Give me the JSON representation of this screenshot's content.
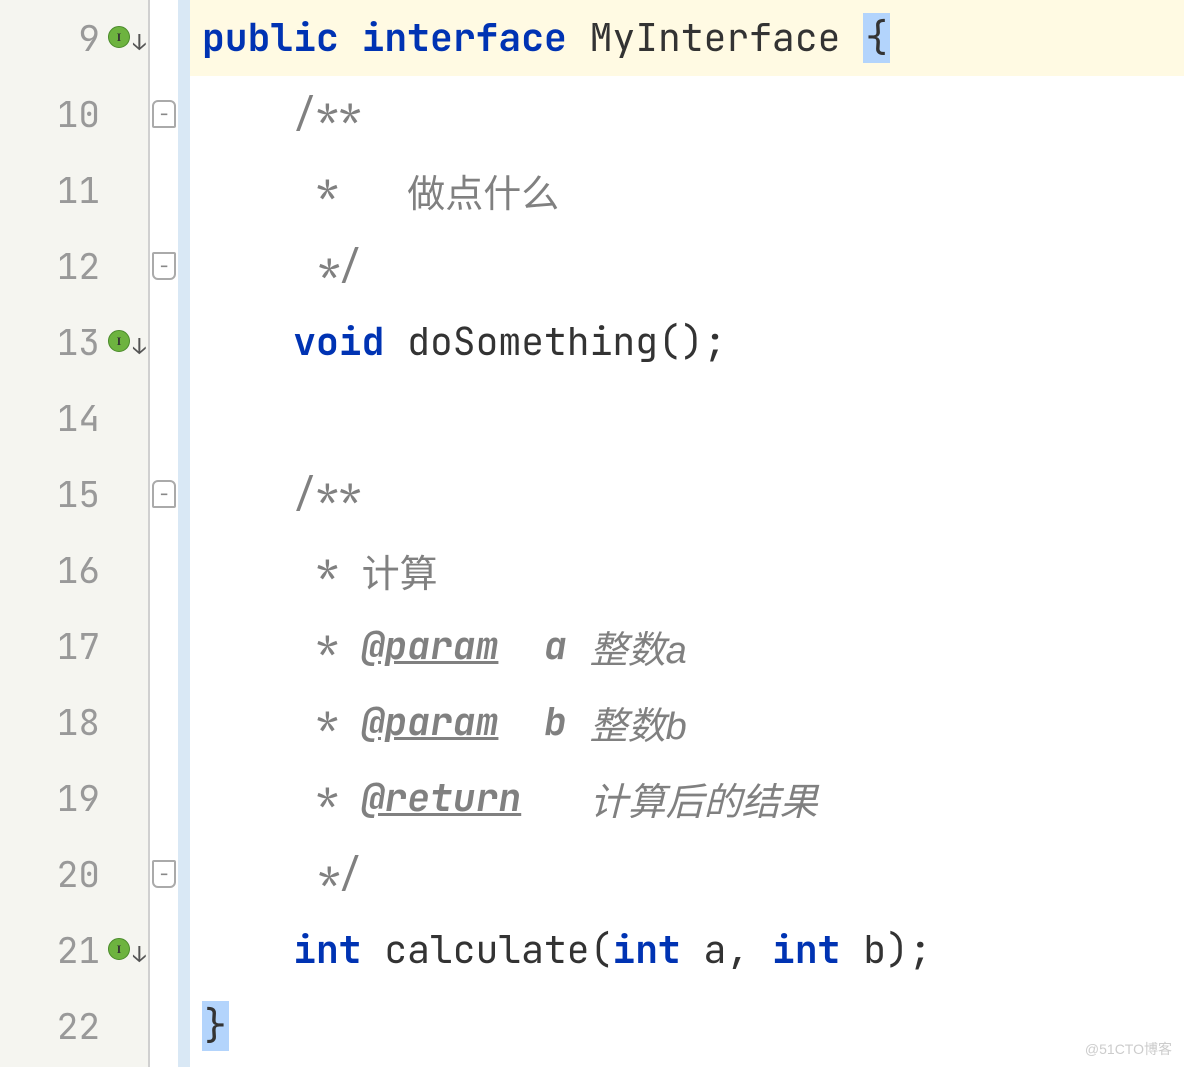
{
  "lines": [
    {
      "num": "9",
      "highlight": true,
      "hasImplMarker": true,
      "foldMarker": "none",
      "tokens": [
        {
          "text": "public",
          "cls": "keyword"
        },
        {
          "text": " ",
          "cls": ""
        },
        {
          "text": "interface",
          "cls": "keyword"
        },
        {
          "text": " ",
          "cls": ""
        },
        {
          "text": "MyInterface ",
          "cls": "identifier"
        },
        {
          "text": "{",
          "cls": "brace-highlight"
        }
      ]
    },
    {
      "num": "10",
      "highlight": false,
      "hasImplMarker": false,
      "foldMarker": "top",
      "tokens": [
        {
          "text": "    /**",
          "cls": "comment"
        }
      ]
    },
    {
      "num": "11",
      "highlight": false,
      "hasImplMarker": false,
      "foldMarker": "none",
      "tokens": [
        {
          "text": "     *   ",
          "cls": "comment"
        },
        {
          "text": "做点什么",
          "cls": "comment cn"
        }
      ]
    },
    {
      "num": "12",
      "highlight": false,
      "hasImplMarker": false,
      "foldMarker": "bottom",
      "tokens": [
        {
          "text": "     */",
          "cls": "comment"
        }
      ]
    },
    {
      "num": "13",
      "highlight": false,
      "hasImplMarker": true,
      "foldMarker": "none",
      "tokens": [
        {
          "text": "    ",
          "cls": ""
        },
        {
          "text": "void",
          "cls": "keyword"
        },
        {
          "text": " doSomething();",
          "cls": "identifier"
        }
      ]
    },
    {
      "num": "14",
      "highlight": false,
      "hasImplMarker": false,
      "foldMarker": "none",
      "tokens": []
    },
    {
      "num": "15",
      "highlight": false,
      "hasImplMarker": false,
      "foldMarker": "top",
      "tokens": [
        {
          "text": "    /**",
          "cls": "comment"
        }
      ]
    },
    {
      "num": "16",
      "highlight": false,
      "hasImplMarker": false,
      "foldMarker": "none",
      "tokens": [
        {
          "text": "     * ",
          "cls": "comment"
        },
        {
          "text": "计算",
          "cls": "comment cn"
        }
      ]
    },
    {
      "num": "17",
      "highlight": false,
      "hasImplMarker": false,
      "foldMarker": "none",
      "tokens": [
        {
          "text": "     * ",
          "cls": "comment"
        },
        {
          "text": "@param",
          "cls": "javadoc-tag"
        },
        {
          "text": "  ",
          "cls": "comment"
        },
        {
          "text": "a",
          "cls": "javadoc-param"
        },
        {
          "text": " ",
          "cls": "comment"
        },
        {
          "text": "整数a",
          "cls": "comment cn italic"
        }
      ]
    },
    {
      "num": "18",
      "highlight": false,
      "hasImplMarker": false,
      "foldMarker": "none",
      "tokens": [
        {
          "text": "     * ",
          "cls": "comment"
        },
        {
          "text": "@param",
          "cls": "javadoc-tag"
        },
        {
          "text": "  ",
          "cls": "comment"
        },
        {
          "text": "b",
          "cls": "javadoc-param"
        },
        {
          "text": " ",
          "cls": "comment"
        },
        {
          "text": "整数b",
          "cls": "comment cn italic"
        }
      ]
    },
    {
      "num": "19",
      "highlight": false,
      "hasImplMarker": false,
      "foldMarker": "none",
      "tokens": [
        {
          "text": "     * ",
          "cls": "comment"
        },
        {
          "text": "@return",
          "cls": "javadoc-tag"
        },
        {
          "text": "   ",
          "cls": "comment"
        },
        {
          "text": "计算后的结果",
          "cls": "comment cn italic"
        }
      ]
    },
    {
      "num": "20",
      "highlight": false,
      "hasImplMarker": false,
      "foldMarker": "bottom",
      "tokens": [
        {
          "text": "     */",
          "cls": "comment"
        }
      ]
    },
    {
      "num": "21",
      "highlight": false,
      "hasImplMarker": true,
      "foldMarker": "none",
      "tokens": [
        {
          "text": "    ",
          "cls": ""
        },
        {
          "text": "int",
          "cls": "keyword"
        },
        {
          "text": " calculate(",
          "cls": "identifier"
        },
        {
          "text": "int",
          "cls": "keyword"
        },
        {
          "text": " a, ",
          "cls": "identifier"
        },
        {
          "text": "int",
          "cls": "keyword"
        },
        {
          "text": " b);",
          "cls": "identifier"
        }
      ]
    },
    {
      "num": "22",
      "highlight": false,
      "hasImplMarker": false,
      "foldMarker": "none",
      "tokens": [
        {
          "text": "}",
          "cls": "brace-highlight"
        }
      ]
    }
  ],
  "watermark": "@51CTO博客"
}
